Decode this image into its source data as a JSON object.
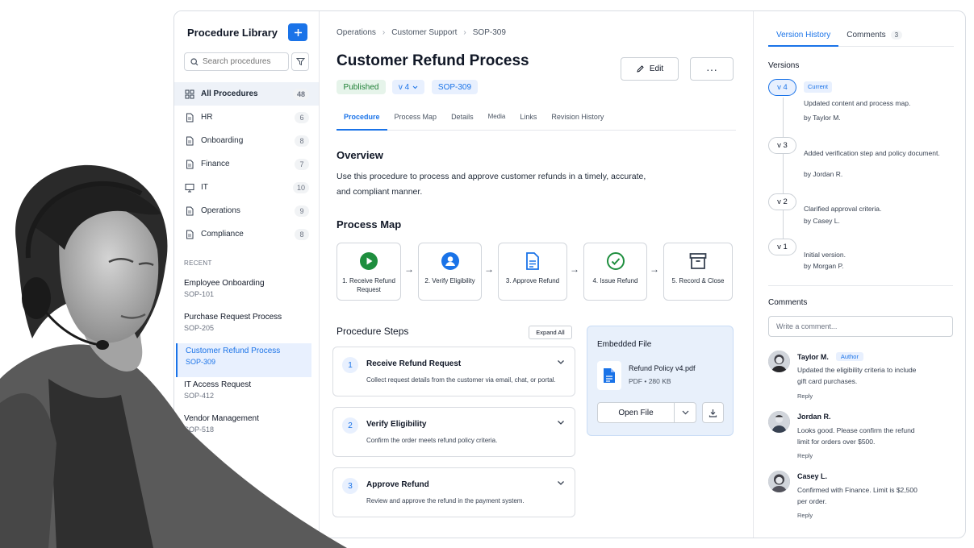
{
  "sidebar": {
    "title": "Procedure Library",
    "add_label": "+",
    "search_placeholder": "Search procedures",
    "categories": [
      {
        "label": "All Procedures",
        "count": "48",
        "icon": "grid-icon"
      },
      {
        "label": "HR",
        "count": "6",
        "icon": "document-icon"
      },
      {
        "label": "Onboarding",
        "count": "8",
        "icon": "document-icon"
      },
      {
        "label": "Finance",
        "count": "7",
        "icon": "document-icon"
      },
      {
        "label": "IT",
        "count": "10",
        "icon": "monitor-icon"
      },
      {
        "label": "Operations",
        "count": "9",
        "icon": "document-icon"
      },
      {
        "label": "Compliance",
        "count": "8",
        "icon": "document-icon"
      }
    ],
    "recent_heading": "RECENT",
    "recent": [
      {
        "title": "Employee Onboarding",
        "code": "SOP-101"
      },
      {
        "title": "Purchase Request Process",
        "code": "SOP-205"
      },
      {
        "title": "Customer Refund Process",
        "code": "SOP-309"
      },
      {
        "title": "IT Access Request",
        "code": "SOP-412"
      },
      {
        "title": "Vendor Management",
        "code": "SOP-518"
      }
    ]
  },
  "main": {
    "breadcrumbs": [
      "Operations",
      "Customer Support",
      "SOP-309"
    ],
    "title": "Customer Refund Process",
    "edit_label": "Edit",
    "more_label": "···",
    "status": "Published",
    "version": "v 4",
    "code": "SOP-309",
    "tabs": [
      "Procedure",
      "Process Map",
      "Details",
      "Media",
      "Links",
      "Revision History"
    ],
    "overview_heading": "Overview",
    "overview_text": "Use this procedure to process and approve customer refunds in a timely, accurate, and compliant manner.",
    "process_map_heading": "Process Map",
    "process_steps": [
      {
        "label": "1. Receive Refund Request",
        "icon": "play-icon",
        "color": "#1e8e3e"
      },
      {
        "label": "2. Verify Eligibility",
        "icon": "user-icon",
        "color": "#1a73e8"
      },
      {
        "label": "3. Approve Refund",
        "icon": "document-icon",
        "color": "#1a73e8"
      },
      {
        "label": "4. Issue Refund",
        "icon": "check-circle-icon",
        "color": "#1e8e3e"
      },
      {
        "label": "5. Record & Close",
        "icon": "archive-icon",
        "color": "#374151"
      }
    ],
    "steps_heading": "Procedure Steps",
    "expand_label": "Expand All",
    "steps": [
      {
        "num": "1",
        "title": "Receive Refund Request",
        "desc": "Collect request details from the customer via email, chat, or portal."
      },
      {
        "num": "2",
        "title": "Verify Eligibility",
        "desc": "Confirm the order meets refund policy criteria."
      },
      {
        "num": "3",
        "title": "Approve Refund",
        "desc": "Review and approve the refund in the payment system."
      }
    ],
    "embedded": {
      "heading": "Embedded File",
      "file_name": "Refund Policy v4.pdf",
      "file_meta": "PDF • 280 KB",
      "open_label": "Open File"
    }
  },
  "right": {
    "tabs": [
      {
        "label": "Version History"
      },
      {
        "label": "Comments",
        "count": "3"
      }
    ],
    "versions_heading": "Versions",
    "versions": [
      {
        "tag": "v 4",
        "current_label": "Current",
        "text": "Updated content and process map.",
        "by": "by Taylor M."
      },
      {
        "tag": "v 3",
        "text": "Added verification step and policy document.",
        "by": "by Jordan R."
      },
      {
        "tag": "v 2",
        "text": "Clarified approval criteria.",
        "by": "by Casey L."
      },
      {
        "tag": "v 1",
        "text": "Initial version.",
        "by": "by Morgan P."
      }
    ],
    "comments_heading": "Comments",
    "comment_placeholder": "Write a comment...",
    "comments": [
      {
        "name": "Taylor M.",
        "tag": "Author",
        "text": "Updated the eligibility criteria to include gift card purchases.",
        "reply": "Reply"
      },
      {
        "name": "Jordan R.",
        "text": "Looks good. Please confirm the refund limit for orders over $500.",
        "reply": "Reply"
      },
      {
        "name": "Casey L.",
        "text": "Confirmed with Finance. Limit is $2,500 per order.",
        "reply": "Reply"
      }
    ]
  },
  "colors": {
    "accent": "#1a73e8",
    "success": "#1e8e3e"
  }
}
